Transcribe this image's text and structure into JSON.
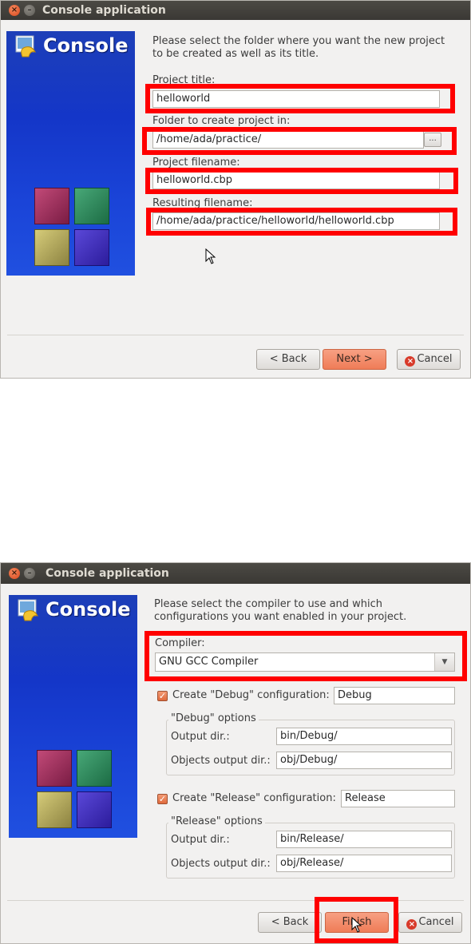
{
  "window1": {
    "title": "Console application",
    "banner_title": "Console",
    "intro": "Please select the folder where you want the new project to be created as well as its title.",
    "project_title_label": "Project title:",
    "project_title_value": "helloworld",
    "folder_label": "Folder to create project in:",
    "folder_value": "/home/ada/practice/",
    "browse_label": "...",
    "filename_label": "Project filename:",
    "filename_value": "helloworld.cbp",
    "resulting_label": "Resulting filename:",
    "resulting_value": "/home/ada/practice/helloworld/helloworld.cbp",
    "back_label": "< Back",
    "next_label": "Next >",
    "cancel_label": "Cancel"
  },
  "window2": {
    "title": "Console application",
    "banner_title": "Console",
    "intro": "Please select the compiler to use and which configurations you want enabled in your project.",
    "compiler_label": "Compiler:",
    "compiler_value": "GNU GCC Compiler",
    "debug_check_label": "Create \"Debug\" configuration:",
    "debug_name": "Debug",
    "debug_group_title": "\"Debug\" options",
    "debug_output_label": "Output dir.:",
    "debug_output_value": "bin/Debug/",
    "debug_obj_label": "Objects output dir.:",
    "debug_obj_value": "obj/Debug/",
    "release_check_label": "Create \"Release\" configuration:",
    "release_name": "Release",
    "release_group_title": "\"Release\" options",
    "release_output_label": "Output dir.:",
    "release_output_value": "bin/Release/",
    "release_obj_label": "Objects output dir.:",
    "release_obj_value": "obj/Release/",
    "back_label": "< Back",
    "finish_label": "Finish",
    "cancel_label": "Cancel"
  },
  "colors": {
    "highlight_box": "#ff0000",
    "primary_button": "#ef7c57",
    "banner_blue": "#1436c8",
    "titlebar": "#3c3b37"
  }
}
